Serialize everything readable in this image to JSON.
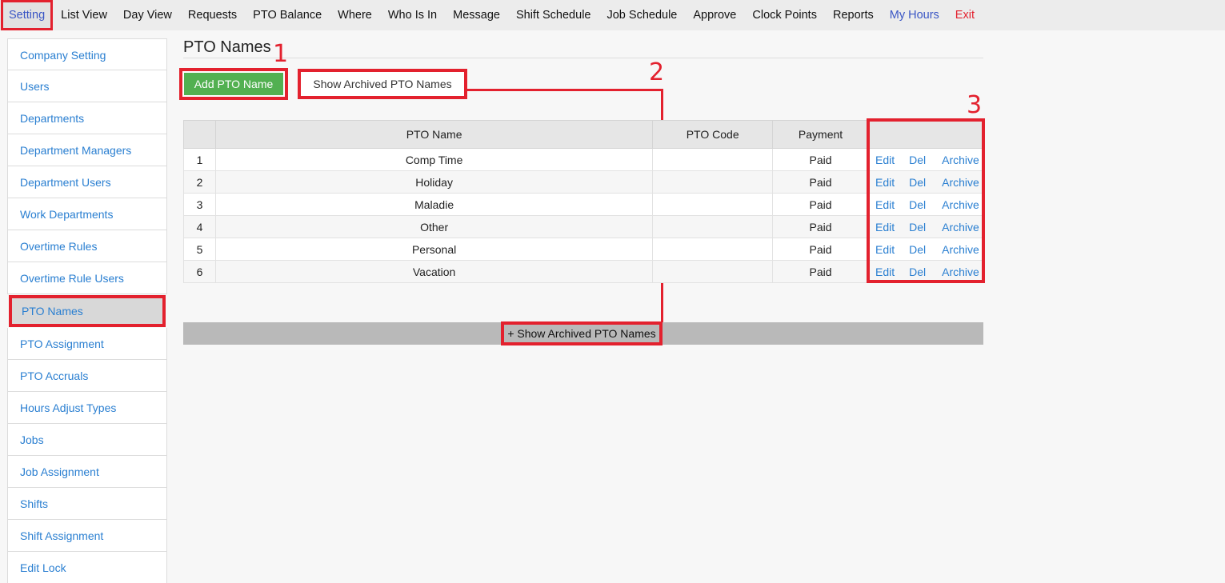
{
  "topnav": {
    "items": [
      {
        "label": "Setting"
      },
      {
        "label": "List View"
      },
      {
        "label": "Day View"
      },
      {
        "label": "Requests"
      },
      {
        "label": "PTO Balance"
      },
      {
        "label": "Where"
      },
      {
        "label": "Who Is In"
      },
      {
        "label": "Message"
      },
      {
        "label": "Shift Schedule"
      },
      {
        "label": "Job Schedule"
      },
      {
        "label": "Approve"
      },
      {
        "label": "Clock Points"
      },
      {
        "label": "Reports"
      },
      {
        "label": "My Hours"
      },
      {
        "label": "Exit"
      }
    ]
  },
  "sidebar": {
    "items": [
      {
        "label": "Company Setting"
      },
      {
        "label": "Users"
      },
      {
        "label": "Departments"
      },
      {
        "label": "Department Managers"
      },
      {
        "label": "Department Users"
      },
      {
        "label": "Work Departments"
      },
      {
        "label": "Overtime Rules"
      },
      {
        "label": "Overtime Rule Users"
      },
      {
        "label": "PTO Names"
      },
      {
        "label": "PTO Assignment"
      },
      {
        "label": "PTO Accruals"
      },
      {
        "label": "Hours Adjust Types"
      },
      {
        "label": "Jobs"
      },
      {
        "label": "Job Assignment"
      },
      {
        "label": "Shifts"
      },
      {
        "label": "Shift Assignment"
      },
      {
        "label": "Edit Lock"
      }
    ]
  },
  "main": {
    "title": "PTO Names",
    "add_button": "Add PTO Name",
    "show_archived_button": "Show Archived PTO Names",
    "archived_toggle": "+ Show Archived PTO Names",
    "annotations": [
      "1",
      "2",
      "3"
    ],
    "table": {
      "headers": [
        "",
        "PTO Name",
        "PTO Code",
        "Payment",
        ""
      ],
      "action_labels": [
        "Edit",
        "Del",
        "Archive"
      ],
      "rows": [
        {
          "num": "1",
          "name": "Comp Time",
          "code": "",
          "payment": "Paid"
        },
        {
          "num": "2",
          "name": "Holiday",
          "code": "",
          "payment": "Paid"
        },
        {
          "num": "3",
          "name": "Maladie",
          "code": "",
          "payment": "Paid"
        },
        {
          "num": "4",
          "name": "Other",
          "code": "",
          "payment": "Paid"
        },
        {
          "num": "5",
          "name": "Personal",
          "code": "",
          "payment": "Paid"
        },
        {
          "num": "6",
          "name": "Vacation",
          "code": "",
          "payment": "Paid"
        }
      ]
    }
  },
  "colors": {
    "accent_link": "#2a7fd1",
    "annotation_red": "#e3212e",
    "add_button_green": "#52b051"
  }
}
